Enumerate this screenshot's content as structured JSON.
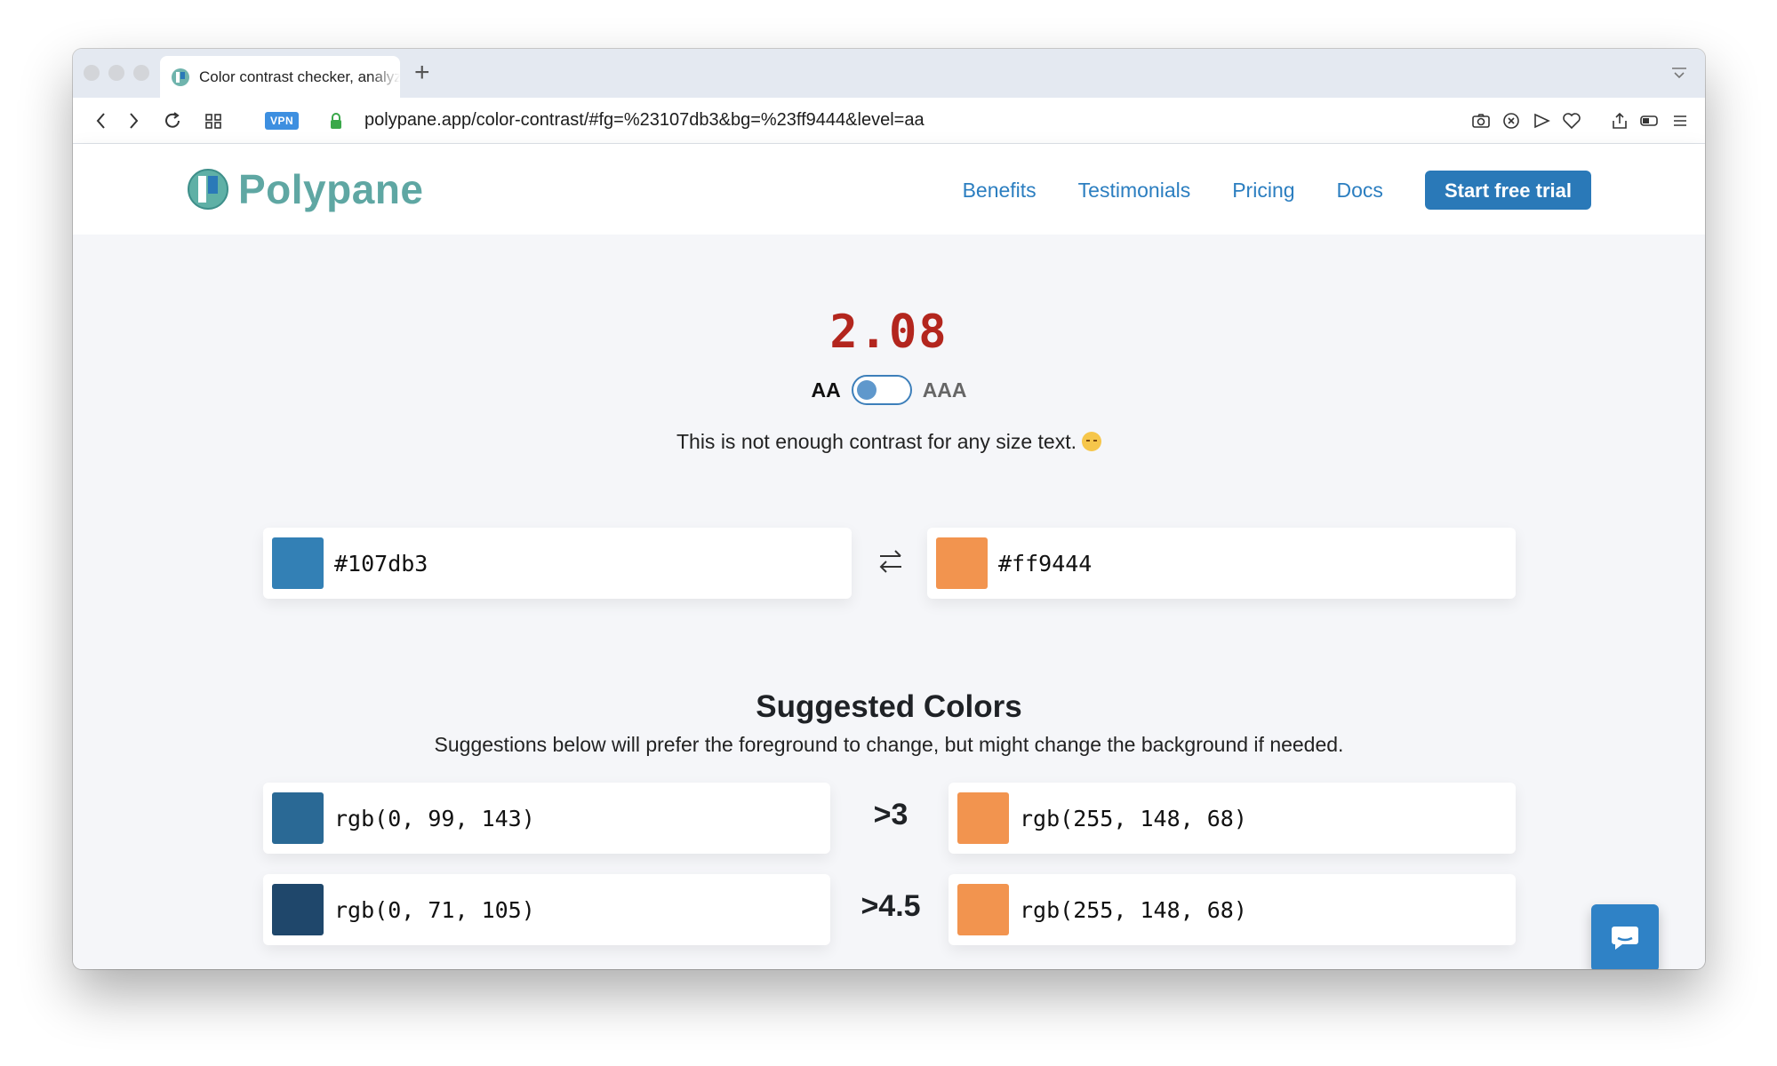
{
  "browser": {
    "tab_title": "Color contrast checker, analyzer",
    "new_tab_label": "+",
    "vpn_label": "VPN",
    "url": "polypane.app/color-contrast/#fg=%23107db3&bg=%23ff9444&level=aa"
  },
  "site": {
    "logo_text": "Polypane",
    "nav": [
      {
        "label": "Benefits"
      },
      {
        "label": "Testimonials"
      },
      {
        "label": "Pricing"
      },
      {
        "label": "Docs"
      }
    ],
    "cta_label": "Start free trial"
  },
  "checker": {
    "ratio": "2.08",
    "level_aa": "AA",
    "level_aaa": "AAA",
    "message": "This is not enough contrast for any size text.",
    "foreground": {
      "value": "#107db3",
      "color": "#3380b5"
    },
    "background": {
      "value": "#ff9444",
      "color": "#f2944f"
    }
  },
  "suggestions": {
    "title": "Suggested Colors",
    "description": "Suggestions below will prefer the foreground to change, but might change the background if needed.",
    "rows": [
      {
        "threshold": ">3",
        "foreground": {
          "value": "rgb(0, 99, 143)",
          "color": "#2a6995"
        },
        "background": {
          "value": "rgb(255, 148, 68)",
          "color": "#f2944f"
        }
      },
      {
        "threshold": ">4.5",
        "foreground": {
          "value": "rgb(0, 71, 105)",
          "color": "#1f476b"
        },
        "background": {
          "value": "rgb(255, 148, 68)",
          "color": "#f2944f"
        }
      }
    ]
  },
  "colors": {
    "ratio_fail": "#b3261e",
    "link": "#2b7ec0",
    "cta": "#2a79b8",
    "chat_button": "#2f82c6"
  }
}
